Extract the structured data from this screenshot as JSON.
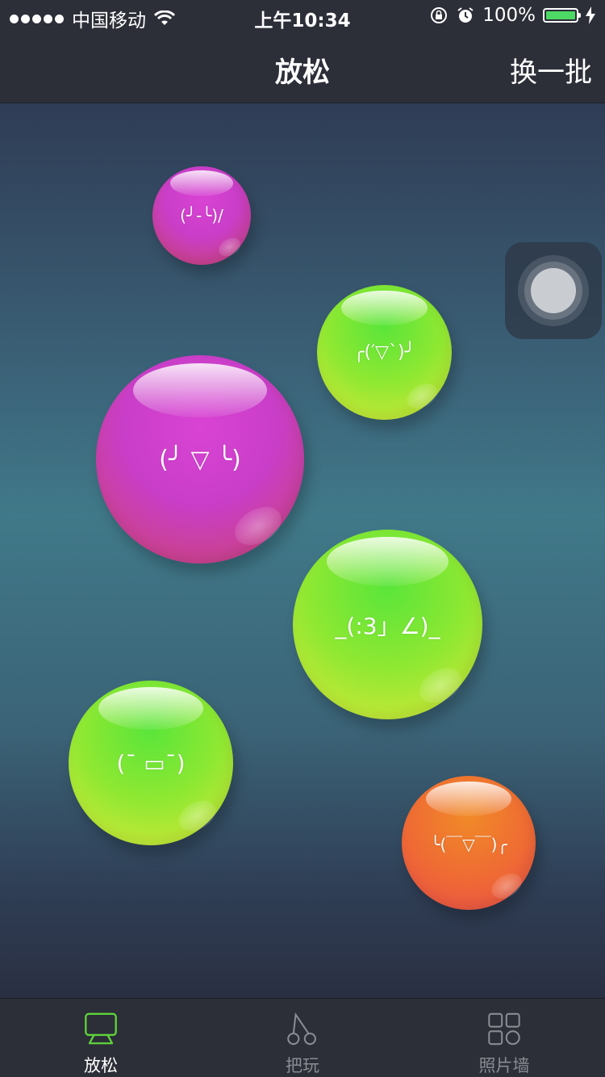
{
  "status_bar": {
    "carrier": "中国移动",
    "time": "上午10:34",
    "battery": "100%",
    "battery_level": 1.0,
    "battery_color": "#4cd964"
  },
  "nav": {
    "title": "放松",
    "action": "换一批"
  },
  "bubbles": [
    {
      "face": "(╯-╰)/",
      "color": "pink"
    },
    {
      "face": "╭(′▽`)╯",
      "color": "green"
    },
    {
      "face": "(╯ ▽ ╰)",
      "color": "pink"
    },
    {
      "face": "_(:3」∠)_",
      "color": "green"
    },
    {
      "face": "(¯ ▭¯)",
      "color": "green"
    },
    {
      "face": "╰(￣▽￣)╭",
      "color": "orange"
    }
  ],
  "tabs": [
    {
      "label": "放松",
      "icon": "chat-bubble-icon",
      "active": true
    },
    {
      "label": "把玩",
      "icon": "cherries-icon",
      "active": false
    },
    {
      "label": "照片墙",
      "icon": "grid-icon",
      "active": false
    }
  ],
  "colors": {
    "active_tab": "#5fd43a",
    "inactive_tab": "#8a8c92"
  }
}
